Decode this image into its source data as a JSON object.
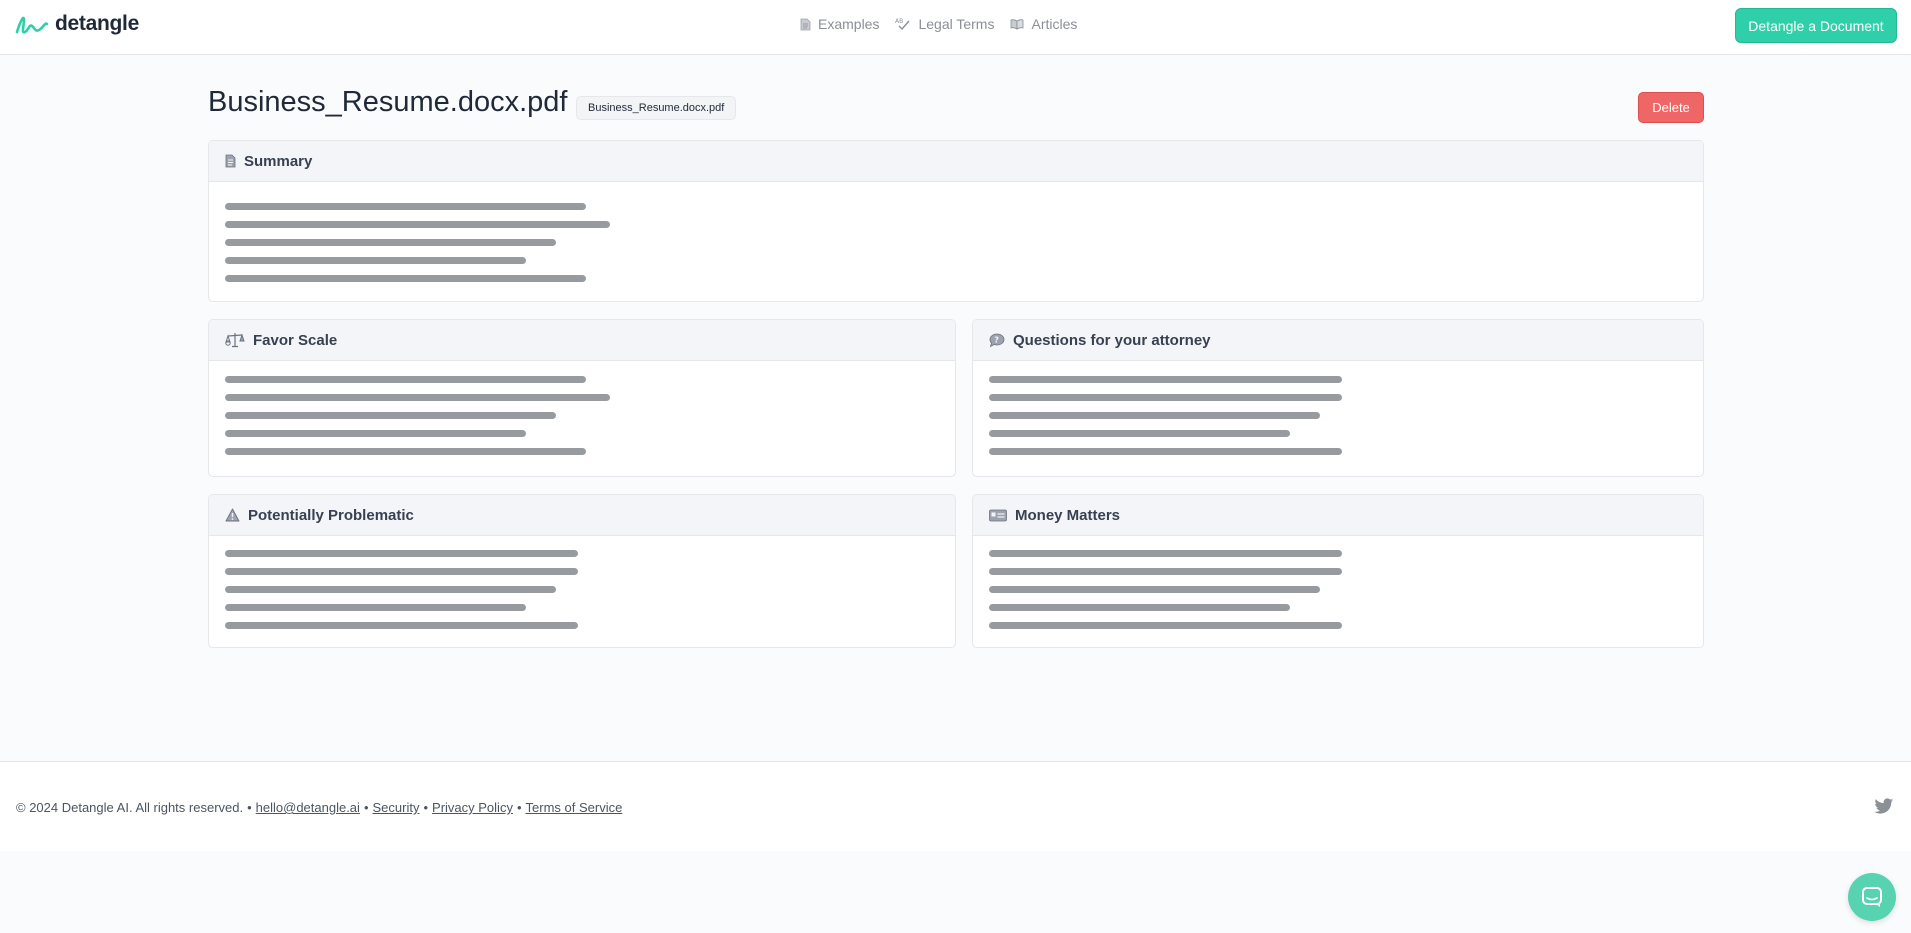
{
  "header": {
    "logo_text": "detangle",
    "nav": [
      {
        "label": "Examples",
        "icon": "document-icon"
      },
      {
        "label": "Legal Terms",
        "icon": "spell-check-icon"
      },
      {
        "label": "Articles",
        "icon": "book-icon"
      }
    ],
    "cta_label": "Detangle a Document"
  },
  "document": {
    "title": "Business_Resume.docx.pdf",
    "badge": "Business_Resume.docx.pdf",
    "delete_label": "Delete"
  },
  "cards": {
    "summary": {
      "title": "Summary",
      "icon": "document-icon"
    },
    "favor": {
      "title": "Favor Scale",
      "icon": "scale-icon"
    },
    "questions": {
      "title": "Questions for your attorney",
      "icon": "chat-question-icon"
    },
    "problematic": {
      "title": "Potentially Problematic",
      "icon": "warning-icon"
    },
    "money": {
      "title": "Money Matters",
      "icon": "money-icon"
    }
  },
  "footer": {
    "copyright": "© 2024 Detangle AI. All rights reserved.",
    "links": [
      "hello@detangle.ai",
      "Security",
      "Privacy Policy",
      "Terms of Service"
    ]
  },
  "colors": {
    "accent": "#2fd0a9",
    "danger": "#ef6666",
    "skeleton": "#979ba0"
  }
}
